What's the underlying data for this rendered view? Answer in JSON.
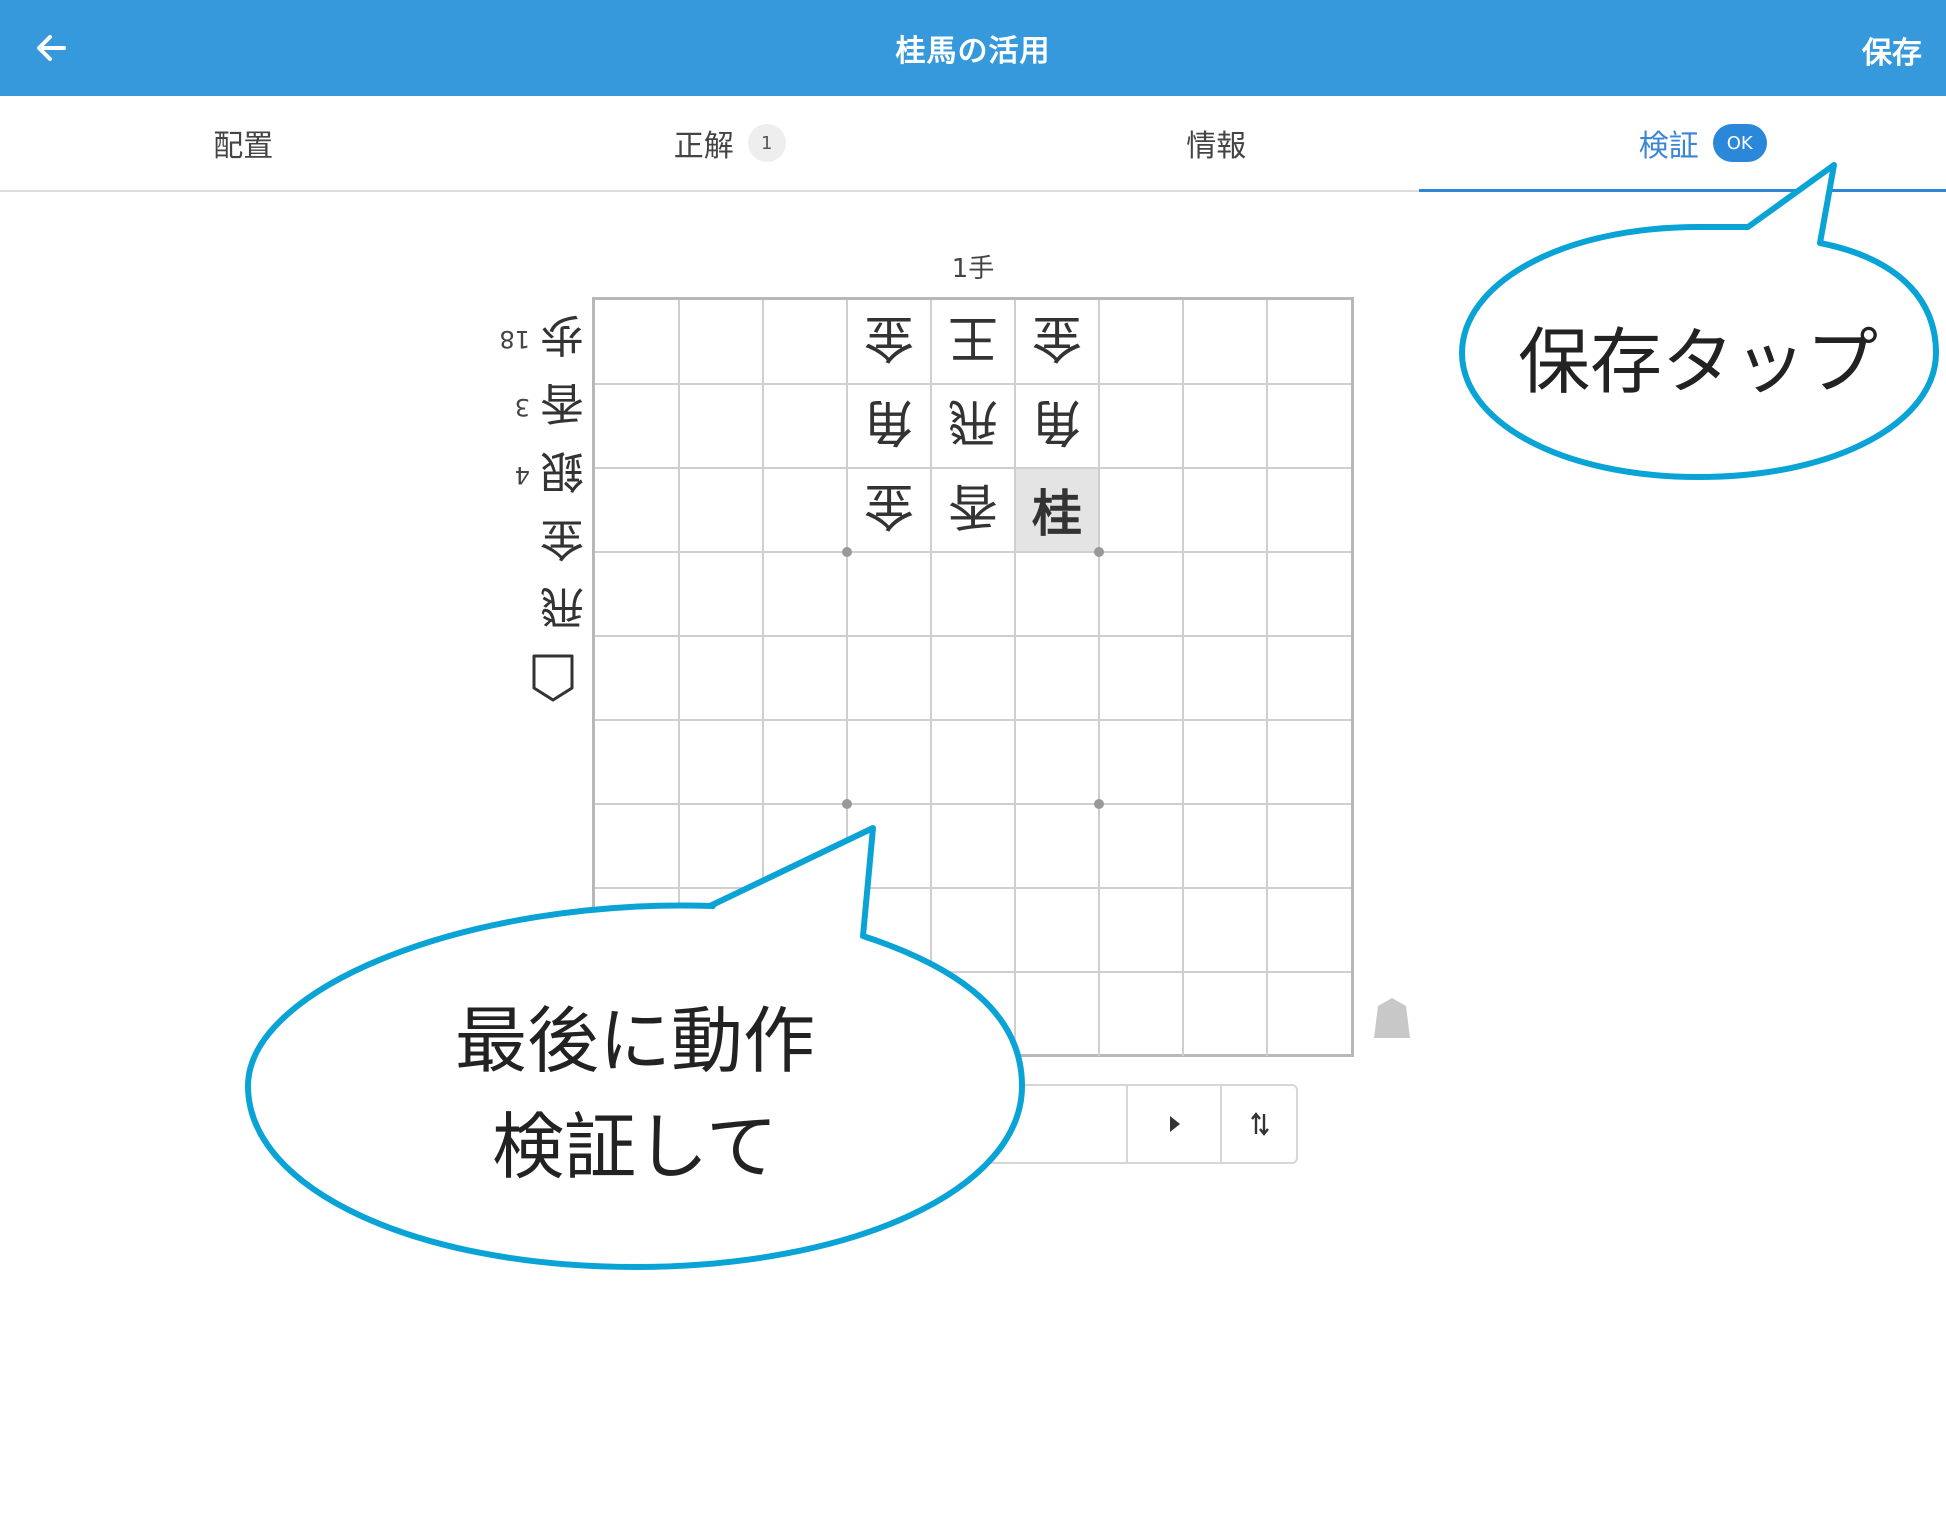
{
  "header": {
    "back_icon": "arrow-left-icon",
    "title": "桂馬の活用",
    "save_label": "保存"
  },
  "tabs": [
    {
      "label": "配置",
      "badge": ""
    },
    {
      "label": "正解",
      "badge": "1"
    },
    {
      "label": "情報",
      "badge": ""
    },
    {
      "label": "検証",
      "badge": "OK",
      "active": true
    }
  ],
  "move_label": "1手",
  "board": {
    "size": 9,
    "gote_pieces": [
      {
        "piece": "金",
        "file": 6,
        "rank": 1
      },
      {
        "piece": "王",
        "file": 5,
        "rank": 1
      },
      {
        "piece": "金",
        "file": 4,
        "rank": 1
      },
      {
        "piece": "角",
        "file": 6,
        "rank": 2
      },
      {
        "piece": "飛",
        "file": 5,
        "rank": 2
      },
      {
        "piece": "角",
        "file": 4,
        "rank": 2
      },
      {
        "piece": "金",
        "file": 6,
        "rank": 3
      },
      {
        "piece": "香",
        "file": 5,
        "rank": 3
      }
    ],
    "sente_pieces": [
      {
        "piece": "桂",
        "file": 4,
        "rank": 3,
        "highlighted": true
      }
    ]
  },
  "gote_hand": [
    {
      "piece": "歩",
      "count": "18"
    },
    {
      "piece": "香",
      "count": "3"
    },
    {
      "piece": "銀",
      "count": "4"
    },
    {
      "piece": "金",
      "count": ""
    },
    {
      "piece": "飛",
      "count": ""
    }
  ],
  "controls": {
    "prev_icon": "prev-icon",
    "next_icon": "play-next-icon",
    "flip_icon": "flip-board-icon"
  },
  "callouts": {
    "top_right": "保存タップ",
    "bottom_line1": "最後に動作",
    "bottom_line2": "検証して"
  },
  "colors": {
    "primary": "#3599dc",
    "accent": "#2b87d9",
    "callout_border": "#0aa3d6"
  }
}
